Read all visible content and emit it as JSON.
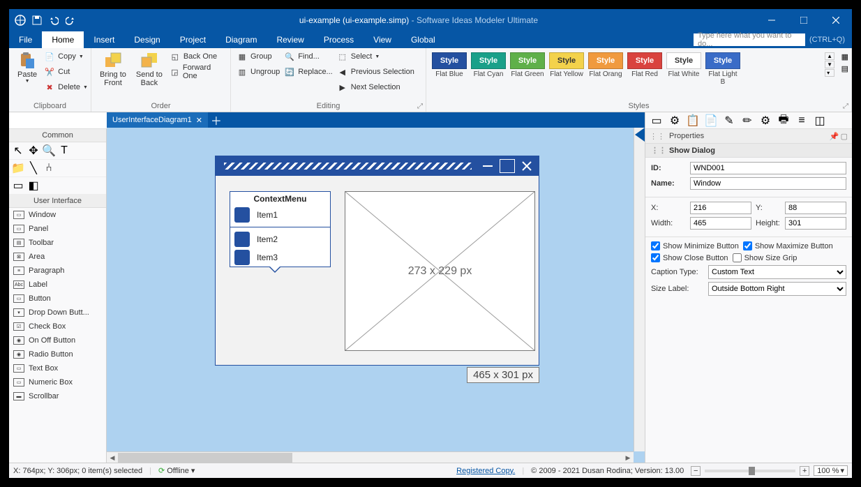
{
  "title": {
    "doc": "ui-example (ui-example.simp)",
    "app": " - Software Ideas Modeler Ultimate"
  },
  "menu": {
    "items": [
      "File",
      "Home",
      "Insert",
      "Design",
      "Project",
      "Diagram",
      "Review",
      "Process",
      "View",
      "Global"
    ],
    "active": 1,
    "search_placeholder": "Type here what you want to do...",
    "shortcut": "(CTRL+Q)"
  },
  "ribbon": {
    "clipboard": {
      "title": "Clipboard",
      "paste": "Paste",
      "copy": "Copy",
      "cut": "Cut",
      "delete": "Delete"
    },
    "order": {
      "title": "Order",
      "bring_front": "Bring to\nFront",
      "send_back": "Send to\nBack",
      "back_one": "Back One",
      "forward_one": "Forward One"
    },
    "editing": {
      "title": "Editing",
      "group": "Group",
      "ungroup": "Ungroup",
      "find": "Find...",
      "replace": "Replace...",
      "select": "Select",
      "prev": "Previous Selection",
      "next": "Next Selection"
    },
    "styles": {
      "title": "Styles",
      "items": [
        {
          "label": "Style",
          "name": "Flat Blue",
          "bg": "#2450a0"
        },
        {
          "label": "Style",
          "name": "Flat Cyan",
          "bg": "#1aa089"
        },
        {
          "label": "Style",
          "name": "Flat Green",
          "bg": "#5fb04a"
        },
        {
          "label": "Style",
          "name": "Flat Yellow",
          "bg": "#f3d24b",
          "fg": "#333"
        },
        {
          "label": "Style",
          "name": "Flat Orang",
          "bg": "#f09a3e"
        },
        {
          "label": "Style",
          "name": "Flat Red",
          "bg": "#d9433e"
        },
        {
          "label": "Style",
          "name": "Flat White",
          "bg": "#ffffff",
          "fg": "#333"
        },
        {
          "label": "Style",
          "name": "Flat Light B",
          "bg": "#3a6cc7"
        }
      ]
    }
  },
  "left": {
    "common": "Common",
    "ui_header": "User Interface",
    "items": [
      "Window",
      "Panel",
      "Toolbar",
      "Area",
      "Paragraph",
      "Label",
      "Button",
      "Drop Down Butt...",
      "Check Box",
      "On Off Button",
      "Radio Button",
      "Text Box",
      "Numeric Box",
      "Scrollbar"
    ]
  },
  "tabs": [
    {
      "name": "UserInterfaceDiagram1"
    }
  ],
  "canvas": {
    "context_title": "ContextMenu",
    "context_items": [
      "Item1",
      "Item2",
      "Item3"
    ],
    "placeholder": "273 x 229 px",
    "window_size": "465 x 301 px"
  },
  "props": {
    "header": "Properties",
    "section": "Show Dialog",
    "id_label": "ID:",
    "id": "WND001",
    "name_label": "Name:",
    "name": "Window",
    "x_label": "X:",
    "x": "216",
    "y_label": "Y:",
    "y": "88",
    "w_label": "Width:",
    "w": "465",
    "h_label": "Height:",
    "h": "301",
    "min": "Show Minimize Button",
    "max": "Show Maximize Button",
    "close": "Show Close Button",
    "grip": "Show Size Grip",
    "caption_label": "Caption Type:",
    "caption": "Custom Text",
    "size_label": "Size Label:",
    "size": "Outside Bottom Right"
  },
  "status": {
    "coords": "X: 764px; Y: 306px; 0 item(s) selected",
    "offline": "Offline",
    "reg": "Registered Copy.",
    "copyright": "© 2009 - 2021 Dusan Rodina; Version: 13.00",
    "zoom": "100 %"
  }
}
